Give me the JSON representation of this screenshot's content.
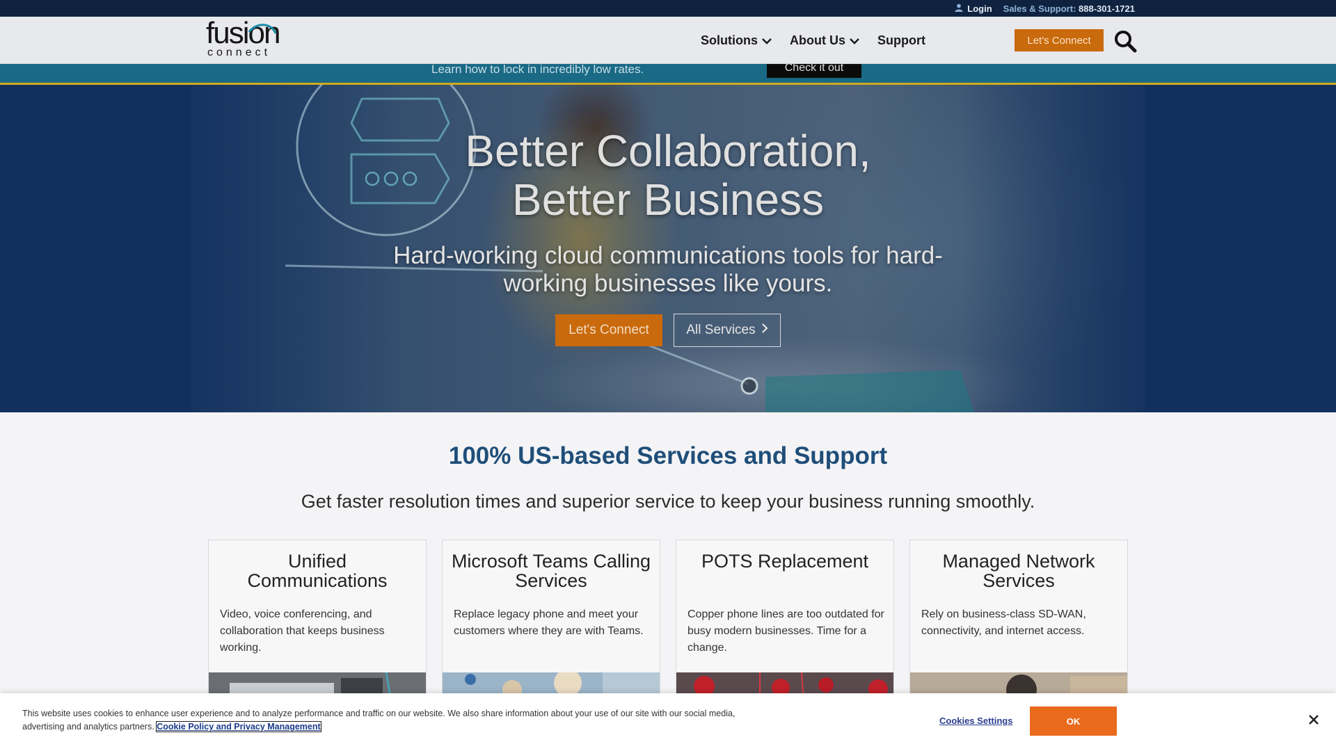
{
  "topbar": {
    "login_label": "Login",
    "support_label": "Sales & Support:",
    "support_phone": "888-301-1721"
  },
  "header": {
    "logo_word1": "fusion",
    "logo_word2": "connect",
    "nav": [
      {
        "label": "Solutions",
        "has_dropdown": true
      },
      {
        "label": "About Us",
        "has_dropdown": true
      },
      {
        "label": "Support",
        "has_dropdown": false
      }
    ],
    "cta_label": "Let's Connect",
    "search_icon": "search-icon"
  },
  "promo": {
    "text": "Learn how to lock in incredibly low rates.",
    "button_label": "Check it out"
  },
  "hero": {
    "title_line1": "Better Collaboration,",
    "title_line2": "Better Business",
    "subtitle": "Hard-working cloud communications tools for hard-working businesses like yours.",
    "cta_label": "Let's Connect",
    "services_label": "All Services"
  },
  "section": {
    "title": "100% US-based Services and Support",
    "subtitle": "Get faster resolution times and superior service to keep your business running smoothly."
  },
  "cards": [
    {
      "title": "Unified Communications",
      "text": "Video, voice conferencing, and collaboration that keeps business working."
    },
    {
      "title": "Microsoft Teams Calling Services",
      "text": "Replace legacy phone and meet your customers where they are with Teams."
    },
    {
      "title": "POTS Replacement",
      "text": "Copper phone lines are too outdated for busy modern businesses. Time for a change."
    },
    {
      "title": "Managed Network Services",
      "text": "Rely on business-class SD-WAN, connectivity, and internet access."
    }
  ],
  "cookie": {
    "text": "This website uses cookies to enhance user experience and to analyze performance and traffic on our website. We also share information about your use of our site with our social media, advertising and analytics partners.",
    "link_label": "Cookie Policy and Privacy Management",
    "settings_label": "Cookies Settings",
    "ok_label": "OK"
  },
  "colors": {
    "navy": "#0f2340",
    "accent_orange": "#c96a0c",
    "heading_blue": "#1f4e79",
    "promo_teal": "#1a6a86",
    "cookie_ok": "#ea6a1e"
  }
}
